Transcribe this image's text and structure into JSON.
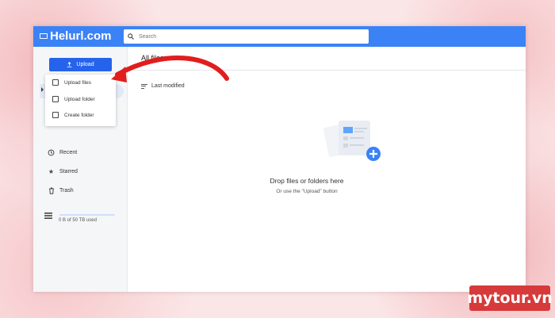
{
  "app": {
    "brand": "Helurl.com"
  },
  "search": {
    "placeholder": "Search"
  },
  "sidebar": {
    "upload_label": "Upload",
    "items": [
      {
        "label": "Recent",
        "icon": "clock-icon"
      },
      {
        "label": "Starred",
        "icon": "star-icon"
      },
      {
        "label": "Trash",
        "icon": "trash-icon"
      }
    ],
    "storage_text": "0 B of 50 TB used",
    "storage_used_fraction": 0
  },
  "upload_menu": {
    "items": [
      {
        "label": "Upload files",
        "icon": "file-upload-icon"
      },
      {
        "label": "Upload folder",
        "icon": "folder-upload-icon"
      },
      {
        "label": "Create folder",
        "icon": "folder-plus-icon"
      }
    ]
  },
  "main": {
    "title": "All files",
    "sort_label": "Last modified",
    "empty_title": "Drop files or folders here",
    "empty_subtitle": "Or use the \"Upload\" button"
  },
  "watermark": {
    "text": "mytour.vn"
  },
  "colors": {
    "accent": "#3b82f6",
    "upload_button": "#2563eb",
    "arrow": "#e11d1d",
    "watermark": "#d63a3a"
  }
}
